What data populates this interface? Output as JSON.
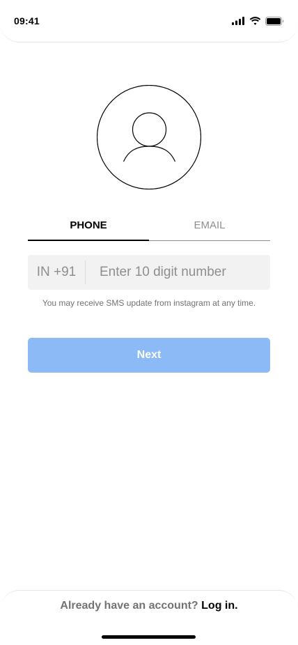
{
  "status_bar": {
    "time": "09:41",
    "icons": [
      "cellular-signal-icon",
      "wifi-icon",
      "battery-icon"
    ]
  },
  "avatar": {
    "icon": "user-avatar-icon"
  },
  "tabs": [
    {
      "label": "PHONE",
      "active": true
    },
    {
      "label": "EMAIL",
      "active": false
    }
  ],
  "phone": {
    "country_code": "IN +91",
    "placeholder": "Enter 10 digit number",
    "value": ""
  },
  "helper_text": "You may receive SMS update from instagram at any time.",
  "next_button": {
    "label": "Next",
    "color": "#8bbaf7"
  },
  "footer": {
    "prompt": "Already have an account?",
    "login_label": "Log in."
  },
  "colors": {
    "primary_disabled": "#8bbaf7",
    "muted_text": "#8e8e8e",
    "input_bg": "#f2f2f2"
  }
}
